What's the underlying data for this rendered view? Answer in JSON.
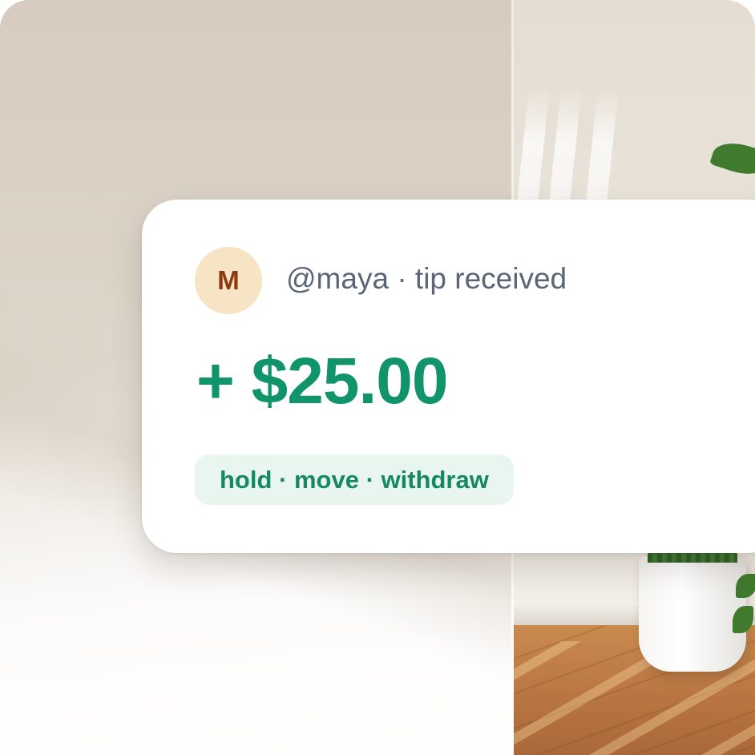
{
  "notification": {
    "avatar_initial": "M",
    "sender_line": "@maya · tip received",
    "amount": "+ $25.00",
    "actions": "hold · move · withdraw"
  },
  "colors": {
    "amount_green": "#119469",
    "pill_background": "#e9f6f0",
    "avatar_background": "#f6e4c4",
    "avatar_letter": "#8a3a12",
    "sender_text": "#5a6678"
  },
  "background": {
    "description_icon": "room-photo"
  }
}
